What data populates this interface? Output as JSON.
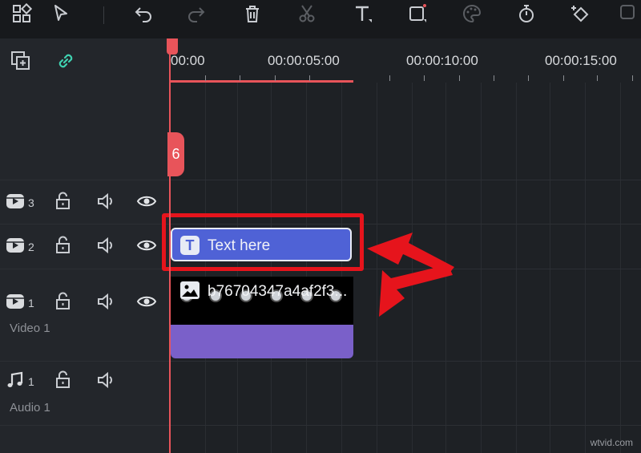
{
  "toolbar": {
    "icons": [
      "grid-icon",
      "select-arrow-icon",
      "undo-icon",
      "redo-icon",
      "delete-icon",
      "cut-icon",
      "text-icon",
      "crop-icon",
      "color-icon",
      "timer-icon",
      "keyframe-icon",
      "more-icon"
    ]
  },
  "ruler": {
    "labels": [
      "00:00",
      "00:00:05:00",
      "00:00:10:00",
      "00:00:15:00"
    ]
  },
  "playhead": {
    "handle_glyph": "6"
  },
  "tracks": {
    "video3": {
      "num": "3"
    },
    "video2": {
      "num": "2"
    },
    "video1": {
      "num": "1",
      "name": "Video 1"
    },
    "audio1": {
      "num": "1",
      "name": "Audio 1"
    }
  },
  "clips": {
    "text_clip": {
      "icon_glyph": "T",
      "label": "Text here"
    },
    "video_clip": {
      "label": "b76704347a4af2f3..."
    }
  },
  "colors": {
    "accent": "#e8545a",
    "text_clip": "#4f62d6",
    "audio_strip": "#7a60c9",
    "highlight": "#e6141c"
  },
  "watermark": "wtvid.com"
}
